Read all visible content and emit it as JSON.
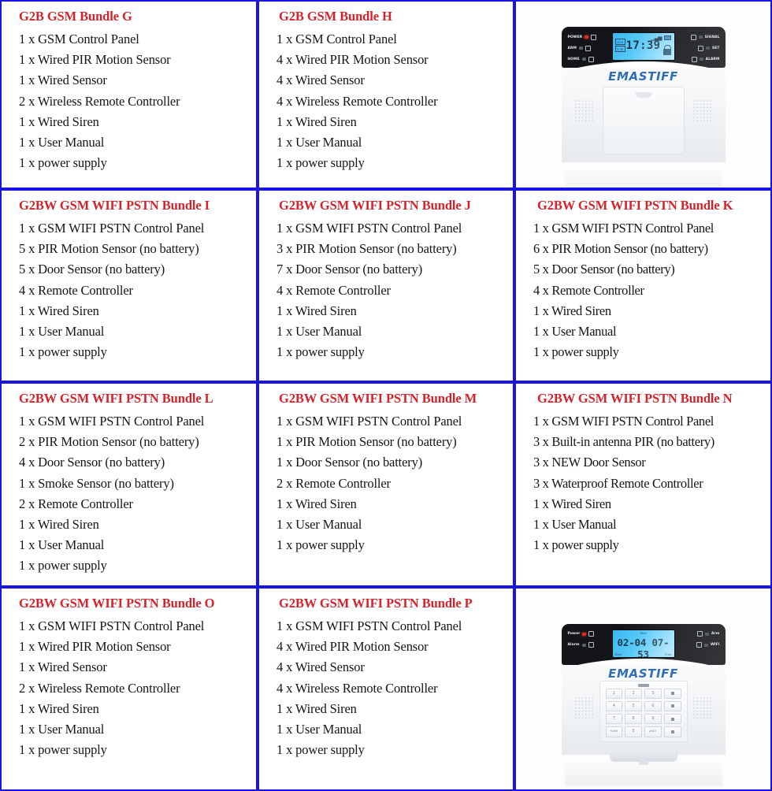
{
  "table": {
    "border_color": "#1a14e0",
    "title_color": "#d4232b",
    "body_text_color": "#151515",
    "columns": 3,
    "rows": 4
  },
  "cells": [
    {
      "kind": "bundle",
      "title": "G2B GSM Bundle G",
      "items": [
        "1 x GSM Control Panel",
        "1 x Wired PIR Motion Sensor",
        "1 x Wired Sensor",
        "2 x Wireless Remote Controller",
        "1 x Wired Siren",
        "1 x User Manual",
        "1 x power supply"
      ]
    },
    {
      "kind": "bundle",
      "title": "G2B GSM Bundle H",
      "items": [
        "1 x GSM Control Panel",
        "4 x Wired PIR Motion Sensor",
        "4 x Wired Sensor",
        "4 x Wireless Remote Controller",
        "1 x Wired Siren",
        "1 x User Manual",
        "1 x power supply"
      ]
    },
    {
      "kind": "photo",
      "photo": {
        "variant": "closed-flap",
        "brand": "EMASTIFF",
        "lcd_time": "17:39",
        "lcd_mini": [
          "23 6",
          "9 30"
        ],
        "lcd_footer_left": "",
        "lcd_footer_right": "",
        "left_indicators": [
          "POWER",
          "ARM",
          "HOME"
        ],
        "right_indicators": [
          "SIGNAL",
          "SET",
          "ALARM"
        ]
      }
    },
    {
      "kind": "bundle",
      "title": "G2BW GSM WIFI PSTN Bundle I",
      "items": [
        "1 x GSM WIFI PSTN Control Panel",
        "5 x PIR Motion Sensor  (no battery)",
        "5 x Door Sensor  (no battery)",
        "4 x Remote Controller",
        "1 x Wired Siren",
        "1 x User Manual",
        "1 x power supply"
      ]
    },
    {
      "kind": "bundle",
      "title": "G2BW GSM WIFI PSTN Bundle J",
      "items": [
        "1 x GSM WIFI PSTN Control Panel",
        "3 x PIR Motion Sensor  (no battery)",
        "7 x Door Sensor  (no battery)",
        "4 x Remote Controller",
        "1 x Wired Siren",
        "1 x User Manual",
        "1 x power supply"
      ]
    },
    {
      "kind": "bundle",
      "title": "G2BW GSM WIFI PSTN Bundle K",
      "items": [
        "1 x GSM WIFI PSTN Control Panel",
        "6 x PIR Motion Sensor  (no battery)",
        "5 x Door Sensor  (no battery)",
        "4 x Remote Controller",
        "1 x Wired Siren",
        "1 x User Manual",
        "1 x power supply"
      ]
    },
    {
      "kind": "bundle",
      "title": "G2BW GSM WIFI PSTN Bundle L",
      "items": [
        "1 x GSM WIFI PSTN Control Panel",
        "2 x PIR Motion Sensor  (no battery)",
        "4 x Door Sensor  (no battery)",
        "1 x Smoke Sensor  (no battery)",
        "2 x Remote Controller",
        "1 x Wired Siren",
        "1 x User Manual",
        "1 x power supply"
      ]
    },
    {
      "kind": "bundle",
      "title": "G2BW GSM WIFI PSTN Bundle M",
      "items": [
        "1 x GSM WIFI PSTN Control Panel",
        "1 x PIR Motion Sensor  (no battery)",
        "1 x Door Sensor  (no battery)",
        "2 x Remote Controller",
        "1 x Wired Siren",
        "1 x User Manual",
        "1 x power supply"
      ]
    },
    {
      "kind": "bundle",
      "title": "G2BW GSM WIFI PSTN Bundle N",
      "items": [
        "1 x GSM WIFI PSTN Control Panel",
        "3 x Built-in antenna PIR (no battery)",
        "3 x NEW Door Sensor",
        "3 x Waterproof Remote Controller",
        "1 x Wired Siren",
        "1 x User Manual",
        "1 x power supply"
      ]
    },
    {
      "kind": "bundle",
      "title": "G2BW GSM WIFI PSTN Bundle O",
      "items": [
        "1 x GSM WIFI PSTN Control Panel",
        "1 x Wired PIR Motion Sensor",
        "1 x Wired Sensor",
        "2 x Wireless Remote Controller",
        "1 x Wired Siren",
        "1 x User Manual",
        "1 x power supply"
      ]
    },
    {
      "kind": "bundle",
      "title": "G2BW GSM WIFI PSTN Bundle P",
      "items": [
        "1 x GSM WIFI PSTN Control Panel",
        "4 x Wired PIR Motion Sensor",
        "4 x Wired Sensor",
        "4 x Wireless Remote Controller",
        "1 x Wired Siren",
        "1 x User Manual",
        "1 x power supply"
      ]
    },
    {
      "kind": "photo",
      "photo": {
        "variant": "open-keypad",
        "brand": "EMASTIFF",
        "lcd_date": "02-04",
        "lcd_time": "07-53",
        "lcd_day": "Wed",
        "lcd_footer_left": "Zone",
        "lcd_footer_right": "Zone",
        "left_indicators": [
          "Power",
          "Alarm"
        ],
        "right_indicators": [
          "Arm",
          "WIFI"
        ],
        "keypad": [
          "1",
          "2",
          "3",
          "key-icon-1",
          "4",
          "5",
          "6",
          "key-icon-2",
          "7",
          "8",
          "9",
          "key-icon-3",
          "*ARM",
          "0",
          "#SET",
          "key-icon-4"
        ]
      }
    }
  ]
}
